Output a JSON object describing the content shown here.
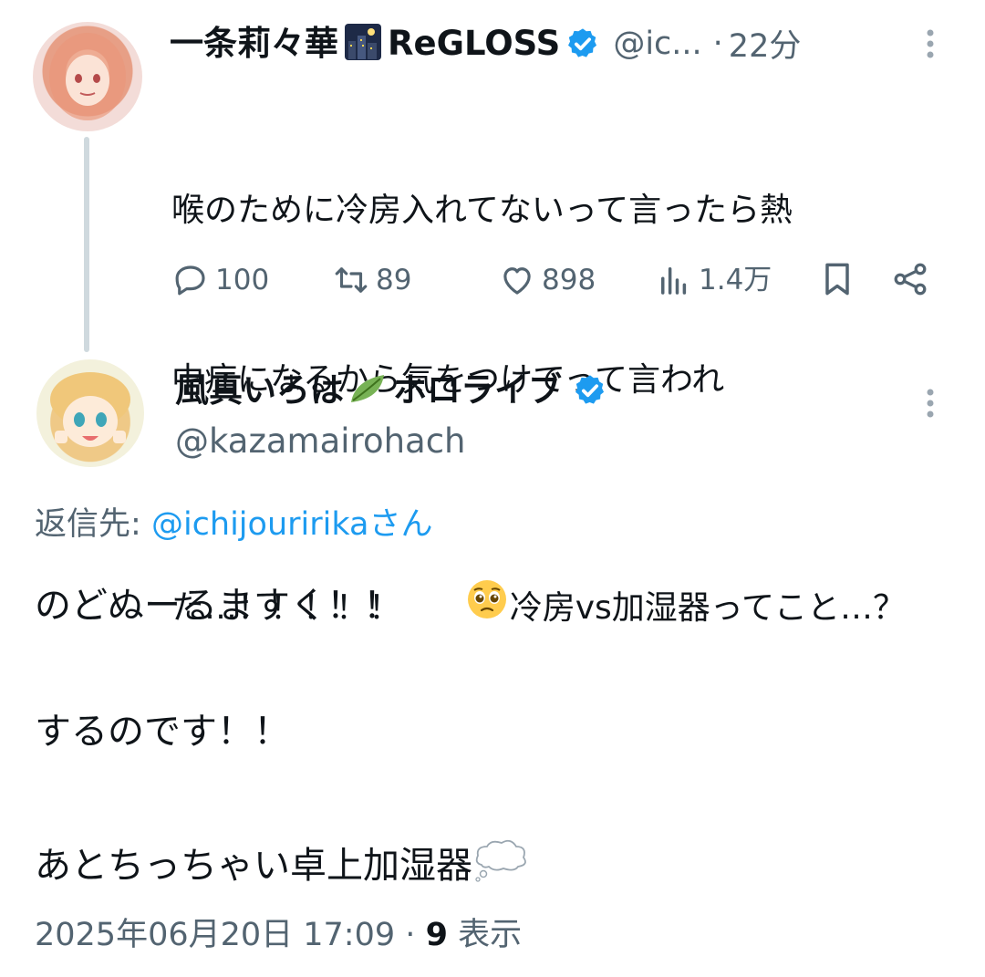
{
  "parent_tweet": {
    "author_name": "一条莉々華",
    "author_suffix": "ReGLOSS",
    "handle": "@ic...",
    "separator": "·",
    "time_ago": "22分",
    "text_line1": "喉のために冷房入れてないって言ったら熱",
    "text_line2": "中症になるから気をつけてって言われ",
    "text_line3_a": "た…！！！！！",
    "text_line3_b": "冷房vs加湿器ってこと…？",
    "metrics": {
      "replies": "100",
      "retweets": "89",
      "likes": "898",
      "views": "1.4万"
    }
  },
  "reply_tweet": {
    "author_name": "風真いろは",
    "author_suffix": "ホロライブ",
    "handle": "@kazamairohach",
    "reply_to_label": "返信先:",
    "reply_to_mention": "@ichijouririkaさん",
    "body_line1": "のどぬーるますく！！",
    "body_line2": "するのです！！",
    "body_line3": "あとちっちゃい卓上加湿器",
    "timestamp": "2025年06月20日 17:09",
    "ts_separator": "·",
    "view_count": "9",
    "view_label": "表示"
  },
  "icons": {
    "verified": "verified-badge-icon",
    "more": "more-options-icon",
    "reply": "reply-icon",
    "retweet": "retweet-icon",
    "like": "like-icon",
    "views": "views-icon",
    "bookmark": "bookmark-icon",
    "share": "share-icon"
  },
  "colors": {
    "text": "#0f1419",
    "muted": "#536471",
    "accent": "#1d9bf0",
    "thread_line": "#cfd9de"
  }
}
